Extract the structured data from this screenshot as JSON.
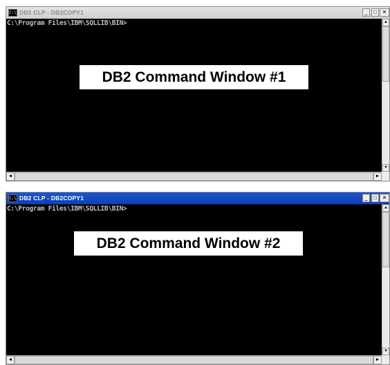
{
  "windows": [
    {
      "title": "DB2 CLP - DB2COPY1",
      "icon": "C:\\",
      "prompt": "C:\\Program Files\\IBM\\SQLLIB\\BIN>",
      "label": "DB2 Command Window #1",
      "active": false
    },
    {
      "title": "DB2 CLP - DB2COPY1",
      "icon": "C:\\",
      "prompt": "C:\\Program Files\\IBM\\SQLLIB\\BIN>",
      "label": "DB2 Command Window #2",
      "active": true
    }
  ],
  "controls": {
    "minimize": "_",
    "maximize": "□",
    "close": "✕",
    "scroll_up": "▲",
    "scroll_down": "▼",
    "scroll_left": "◄",
    "scroll_right": "►"
  },
  "colors": {
    "console_bg": "#000000",
    "console_text": "#c0c0c0",
    "active_title": "#0d40b3",
    "inactive_title": "#d6d6d6"
  }
}
